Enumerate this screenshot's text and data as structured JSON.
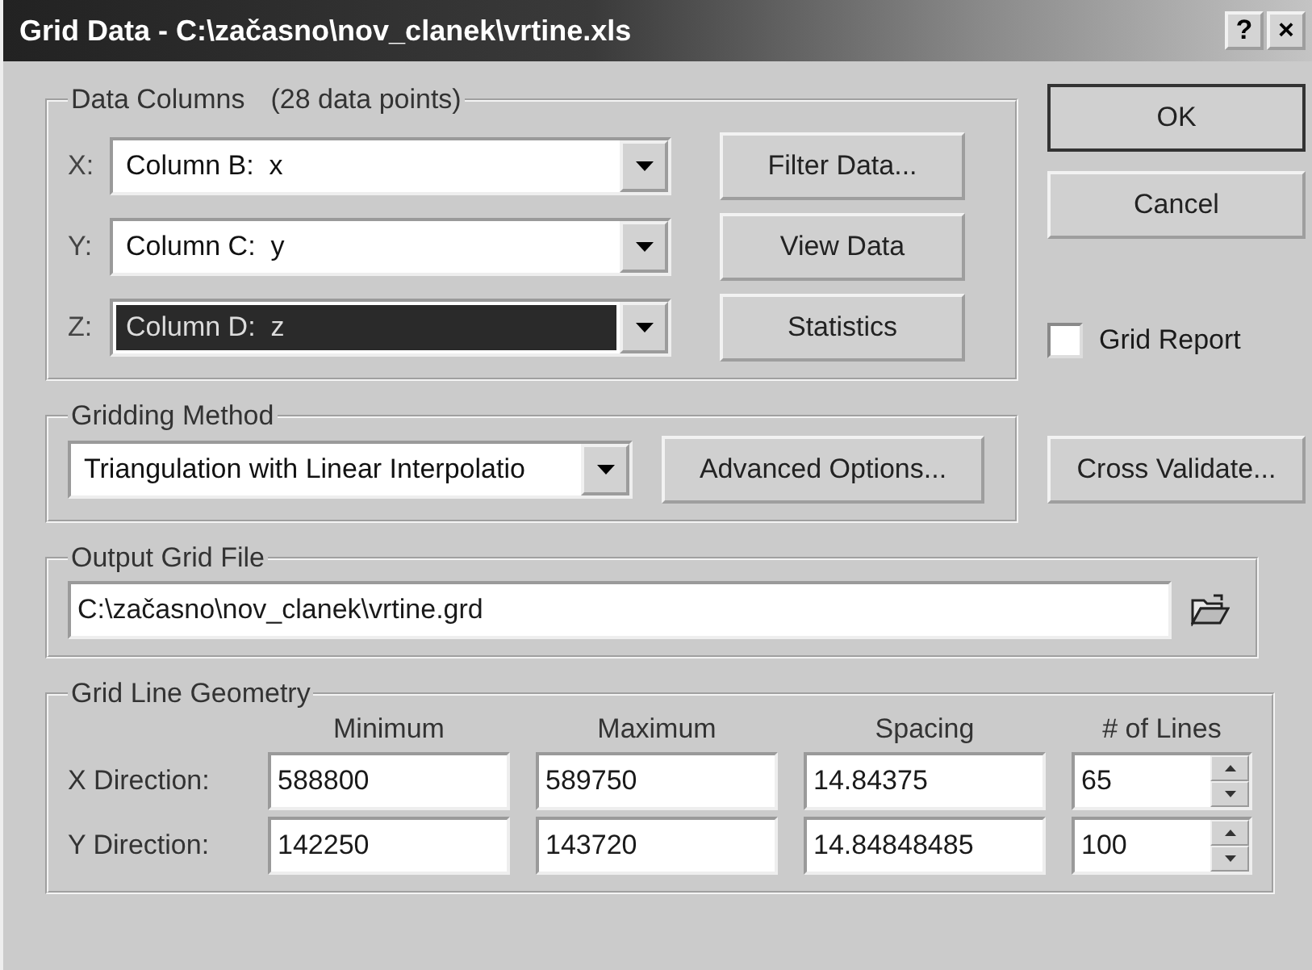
{
  "window": {
    "title": "Grid Data - C:\\začasno\\nov_clanek\\vrtine.xls",
    "title_buttons": [
      "?",
      "×"
    ]
  },
  "data_columns": {
    "label": "Data Columns",
    "count": "(28 data points)",
    "rows": [
      {
        "axis": "X:",
        "value": "Column B:  x",
        "selected": false,
        "button": "Filter Data..."
      },
      {
        "axis": "Y:",
        "value": "Column C:  y",
        "selected": false,
        "button": "View Data"
      },
      {
        "axis": "Z:",
        "value": "Column D:  z",
        "selected": true,
        "button": "Statistics"
      }
    ]
  },
  "side_buttons": [
    {
      "label": "OK",
      "default": true
    },
    {
      "label": "Cancel",
      "default": false
    }
  ],
  "grid_report": {
    "label": "Grid Report",
    "checked": false
  },
  "gridding_method": {
    "label": "Gridding Method",
    "value": "Triangulation with Linear Interpolatio",
    "button": "Advanced Options..."
  },
  "cross_validate": "Cross Validate...",
  "output_grid_file": {
    "label": "Output Grid File",
    "value": "C:\\začasno\\nov_clanek\\vrtine.grd"
  },
  "geometry": {
    "label": "Grid Line Geometry",
    "columns": [
      "Minimum",
      "Maximum",
      "Spacing",
      "# of Lines"
    ],
    "rows": [
      {
        "label": "X Direction:",
        "values": [
          "588800",
          "589750",
          "14.84375",
          "65"
        ]
      },
      {
        "label": "Y Direction:",
        "values": [
          "142250",
          "143720",
          "14.84848485",
          "100"
        ]
      }
    ]
  }
}
